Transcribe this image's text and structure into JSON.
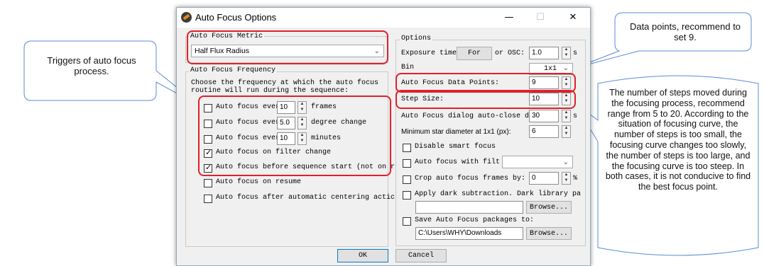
{
  "dialog": {
    "title": "Auto Focus Options",
    "controls": {
      "minimize": "—",
      "maximize": "☐",
      "close": "✕"
    },
    "metric": {
      "group_label": "Auto Focus Metric",
      "selected": "Half Flux Radius"
    },
    "frequency": {
      "group_label": "Auto Focus Frequency",
      "description": "Choose the frequency at which the auto focus routine will run during the sequence:",
      "items": [
        {
          "prefix": "Auto focus ever",
          "value": "10",
          "suffix": "frames",
          "checked": false
        },
        {
          "prefix": "Auto focus ever",
          "value": "5.0",
          "suffix": "degree change",
          "checked": false
        },
        {
          "prefix": "Auto focus ever",
          "value": "10",
          "suffix": "minutes",
          "checked": false
        },
        {
          "label": "Auto focus on filter change",
          "checked": true
        },
        {
          "label": "Auto focus before sequence start (not on r",
          "checked": true
        },
        {
          "label": "Auto focus on resume",
          "checked": false
        },
        {
          "label": "Auto focus after automatic centering actic",
          "checked": false
        }
      ]
    },
    "options": {
      "group_label": "Options",
      "exposure_label": "Exposure time",
      "exposure_button": "For",
      "exposure_or": "or OSC:",
      "exposure_value": "1.0",
      "exposure_unit": "s",
      "bin_label": "Bin",
      "bin_value": "1x1",
      "data_points_label": "Auto Focus Data Points:",
      "data_points_value": "9",
      "step_size_label": "Step Size:",
      "step_size_value": "10",
      "autoclose_label": "Auto Focus dialog auto-close d",
      "autoclose_value": "30",
      "autoclose_unit": "s",
      "min_star_label": "Minimum star diameter at 1x1 (px):",
      "min_star_value": "6",
      "disable_smart": "Disable smart focus",
      "with_filter": "Auto focus with filt",
      "crop_label": "Crop auto focus frames by:",
      "crop_value": "0",
      "crop_unit": "%",
      "dark_label": "Apply dark subtraction.  Dark library pa",
      "browse1": "Browse...",
      "save_label": "Save Auto Focus packages to:",
      "save_path": "C:\\Users\\WHY\\Downloads",
      "browse2": "Browse..."
    },
    "ok": "OK",
    "cancel": "Cancel"
  },
  "callouts": {
    "triggers": "Triggers of auto focus process.",
    "data_points": "Data points, recommend to set 9.",
    "steps": "The number of steps moved during the focusing process, recommend range from 5 to 20. According to the situation of focusing curve, the number of steps is too small, the focusing curve changes too slowly, the number of steps is too large, and the focusing curve is too steep. In both cases, it is not conducive to find the best focus point."
  },
  "colors": {
    "highlight": "#e0202a",
    "callout_border": "#5b8bd6",
    "dialog_bg": "#f0f0f0"
  }
}
